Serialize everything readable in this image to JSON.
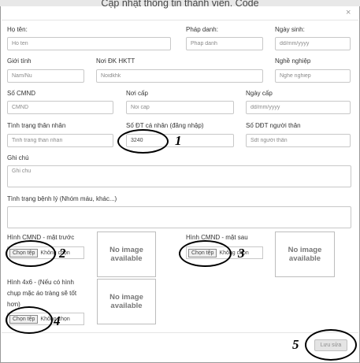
{
  "modal": {
    "title": "Cập nhật thông tin thành viên. Code ",
    "close": "×"
  },
  "fields": {
    "name": {
      "label": "Họ tên:",
      "placeholder": "Ho ten",
      "value": ""
    },
    "position": {
      "label": "Pháp danh:",
      "placeholder": "Phap danh",
      "value": ""
    },
    "birthday": {
      "label": "Ngày sinh:",
      "placeholder": "dd/mm/yyyy",
      "value": ""
    },
    "gender": {
      "label": "Giới tính",
      "placeholder": "Nam/Nu",
      "value": ""
    },
    "household": {
      "label": "Nơi ĐK HKTT",
      "placeholder": "Noidkhk",
      "value": ""
    },
    "occupation": {
      "label": "Nghề nghiệp",
      "placeholder": "Nghe nghiep",
      "value": ""
    },
    "id_number": {
      "label": "Số CMND",
      "placeholder": "CMND",
      "value": ""
    },
    "issue_place": {
      "label": "Nơi cấp",
      "placeholder": "Noi cap",
      "value": ""
    },
    "issue_date": {
      "label": "Ngày cấp",
      "placeholder": "dd/mm/yyyy",
      "value": ""
    },
    "relatives_status": {
      "label": "Tình trạng thân nhân",
      "placeholder": "Tinh trang than nhan",
      "value": ""
    },
    "phone": {
      "label": "Số ĐT cá nhân (đăng nhập)",
      "placeholder": "",
      "value": "3240"
    },
    "relative_phone": {
      "label": "Số DĐT người thân",
      "placeholder": "Sdt người thân",
      "value": ""
    },
    "note": {
      "label": "Ghi chú",
      "placeholder": "Ghi chu",
      "value": ""
    },
    "medical": {
      "label": "Tình trạng bệnh lý (Nhóm máu, khác...)",
      "placeholder": "",
      "value": ""
    }
  },
  "uploads": {
    "front": {
      "label": "Hình CMND - mặt trước",
      "button": "Chọn tệp",
      "status": "Không chọn",
      "preview": [
        "No image",
        "available"
      ]
    },
    "back": {
      "label": "Hình CMND - mặt sau",
      "button": "Chọn tệp",
      "status": "Không chọn",
      "preview": [
        "No image",
        "available"
      ]
    },
    "portrait": {
      "label_lines": [
        "Hình 4x6 - (Nếu có hình",
        "chụp mặc áo tràng sẽ tốt",
        "hơn)"
      ],
      "button": "Chọn tệp",
      "status": "Không chọn",
      "preview": [
        "No image",
        "available"
      ]
    }
  },
  "annotations": [
    "1",
    "2",
    "3",
    "4",
    "5"
  ],
  "footer": {
    "save_label": "Lưu sửa"
  }
}
